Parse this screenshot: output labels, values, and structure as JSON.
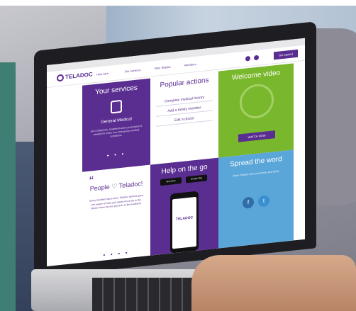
{
  "site": {
    "logo_text": "TELADOC",
    "nav": [
      "How care",
      "Our services",
      "Why Teladoc",
      "Members"
    ],
    "nav_button": "Get started"
  },
  "tiles": {
    "services": {
      "title": "Your services",
      "subtitle": "General Medical",
      "text": "Get a diagnosis, treatment and a prescription if needed for many non-emergency medical conditions."
    },
    "actions": {
      "title": "Popular actions",
      "links": [
        "Complete medical history",
        "Add a family member",
        "Edit a doctor"
      ]
    },
    "video": {
      "title": "Welcome video",
      "button": "WATCH NOW"
    },
    "people": {
      "title": "People ♡ Teladoc!",
      "text": "Every member has a story. Teladoc doctors gave me peace of mind and saved me a trip to the doctor when my son got sick on the weekend."
    },
    "help": {
      "title": "Help on the go",
      "badge_left": "App Store",
      "badge_right": "Google Play",
      "phone_logo": "TELADOC"
    },
    "spread": {
      "title": "Spread the word",
      "text": "Share Teladoc with your friends and family"
    }
  },
  "colors": {
    "brand_purple": "#5a2d91",
    "green": "#79b72c",
    "blue": "#5aa6d9",
    "teal_panel": "#3f7f73"
  }
}
